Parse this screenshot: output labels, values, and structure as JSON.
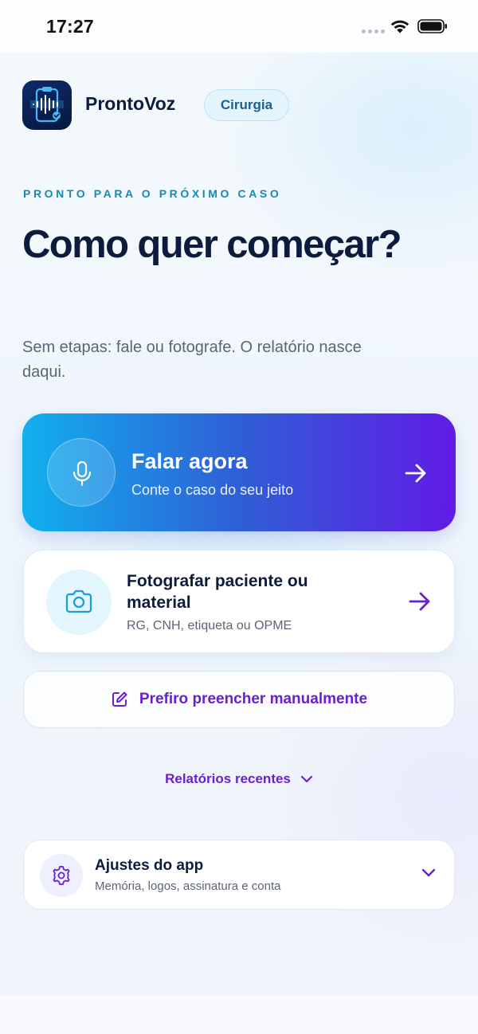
{
  "status_bar": {
    "time": "17:27"
  },
  "header": {
    "app_name": "ProntoVoz",
    "badge": "Cirurgia"
  },
  "intro": {
    "eyebrow": "PRONTO PARA O PRÓXIMO CASO",
    "headline": "Como quer começar?",
    "subtitle": "Sem etapas: fale ou fotografe. O relatório nasce daqui."
  },
  "speak_card": {
    "title": "Falar agora",
    "subtitle": "Conte o caso do seu jeito"
  },
  "photo_card": {
    "title": "Fotografar paciente ou material",
    "subtitle": "RG, CNH, etiqueta ou OPME"
  },
  "manual": {
    "label": "Prefiro preencher manualmente"
  },
  "recent": {
    "label": "Relatórios recentes"
  },
  "settings": {
    "title": "Ajustes do app",
    "subtitle": "Memória, logos, assinatura e conta"
  },
  "colors": {
    "accent_purple": "#6a1fd1",
    "accent_cyan": "#1689b8",
    "navy_text": "#0d1b3d",
    "gradient_start": "#11b0ee",
    "gradient_end": "#611be6"
  },
  "icons": [
    "wifi-icon",
    "battery-icon",
    "app-logo-icon",
    "microphone-icon",
    "arrow-right-icon",
    "camera-icon",
    "edit-icon",
    "chevron-down-icon",
    "gear-icon"
  ]
}
